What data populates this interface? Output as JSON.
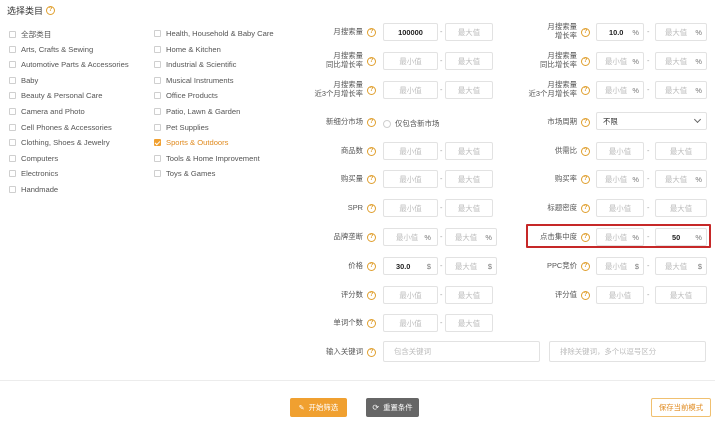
{
  "header": {
    "title": "选择类目"
  },
  "categories": {
    "col1": [
      {
        "label": "全部类目",
        "checked": false
      },
      {
        "label": "Arts, Crafts & Sewing",
        "checked": false
      },
      {
        "label": "Automotive Parts & Accessories",
        "checked": false
      },
      {
        "label": "Baby",
        "checked": false
      },
      {
        "label": "Beauty & Personal Care",
        "checked": false
      },
      {
        "label": "Camera and Photo",
        "checked": false
      },
      {
        "label": "Cell Phones & Accessories",
        "checked": false
      },
      {
        "label": "Clothing, Shoes & Jewelry",
        "checked": false
      },
      {
        "label": "Computers",
        "checked": false
      },
      {
        "label": "Electronics",
        "checked": false
      },
      {
        "label": "Handmade",
        "checked": false
      }
    ],
    "col2": [
      {
        "label": "Health, Household & Baby Care",
        "checked": false
      },
      {
        "label": "Home & Kitchen",
        "checked": false
      },
      {
        "label": "Industrial & Scientific",
        "checked": false
      },
      {
        "label": "Musical Instruments",
        "checked": false
      },
      {
        "label": "Office Products",
        "checked": false
      },
      {
        "label": "Patio, Lawn & Garden",
        "checked": false
      },
      {
        "label": "Pet Supplies",
        "checked": false
      },
      {
        "label": "Sports & Outdoors",
        "checked": true
      },
      {
        "label": "Tools & Home Improvement",
        "checked": false
      },
      {
        "label": "Toys & Games",
        "checked": false
      }
    ]
  },
  "filters": {
    "min_placeholder": "最小值",
    "max_placeholder": "最大值",
    "percent": "%",
    "currency": "$",
    "monthly_search": {
      "label": "月搜索量",
      "min": "100000"
    },
    "monthly_growth": {
      "label1": "月搜索量",
      "label2": "增长率",
      "min": "10.0"
    },
    "yoy_growth_left": {
      "label1": "月搜索量",
      "label2": "同比增长率"
    },
    "yoy_growth_right": {
      "label1": "月搜索量",
      "label2": "同比增长率"
    },
    "three_month_left": {
      "label1": "月搜索量",
      "label2": "近3个月增长率"
    },
    "three_month_right": {
      "label1": "月搜索量",
      "label2": "近3个月增长率"
    },
    "niche_market": {
      "label": "新细分市场",
      "option": "仅包含新市场"
    },
    "market_cycle": {
      "label": "市场周期",
      "value": "不限"
    },
    "products": {
      "label": "商品数"
    },
    "supply_ratio": {
      "label": "供需比"
    },
    "purchases": {
      "label": "购买量"
    },
    "purchase_rate": {
      "label": "购买率"
    },
    "spr": {
      "label": "SPR"
    },
    "title_density": {
      "label": "标题密度"
    },
    "brand_share": {
      "label": "品牌垄断"
    },
    "click_concentration": {
      "label": "点击集中度",
      "max": "50"
    },
    "price": {
      "label": "价格",
      "min": "30.0"
    },
    "ppc_bid": {
      "label": "PPC竞价"
    },
    "review_count": {
      "label": "评分数"
    },
    "rating": {
      "label": "评分值"
    },
    "word_count": {
      "label": "单词个数"
    },
    "keyword_input": {
      "label": "输入关键词",
      "include_placeholder": "包含关键词",
      "exclude_placeholder": "排除关键词，多个以逗号区分"
    }
  },
  "actions": {
    "start": "开始筛选",
    "reset": "重置条件",
    "save": "保存当前模式"
  },
  "colors": {
    "accent": "#f0a030",
    "highlight": "#c62828"
  }
}
